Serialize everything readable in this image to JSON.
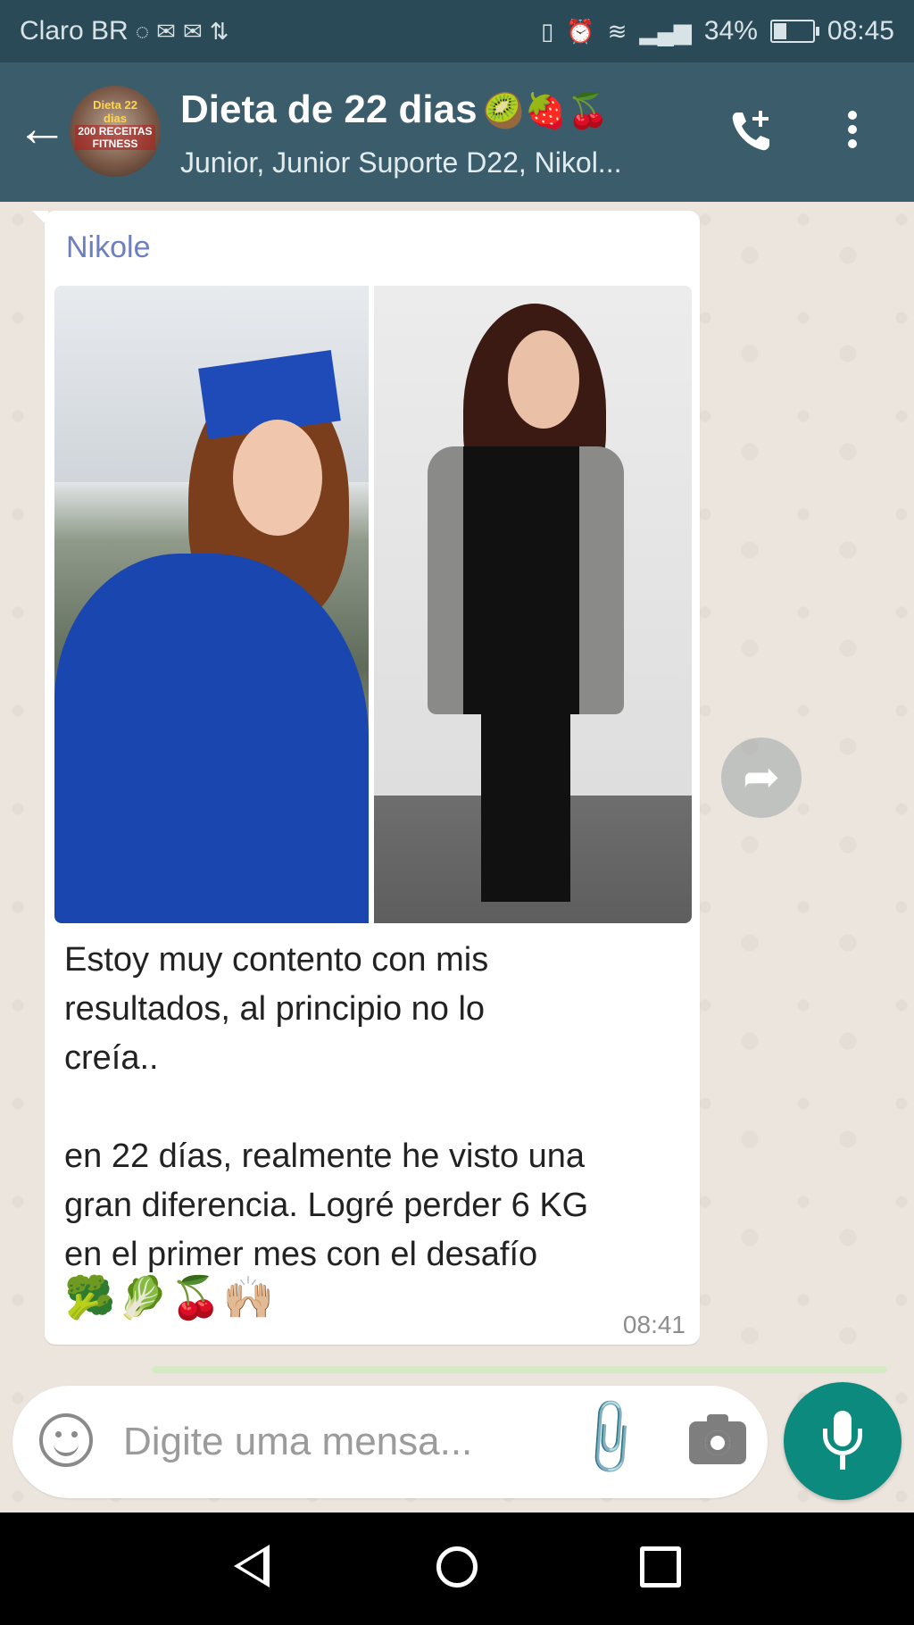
{
  "status_bar": {
    "carrier": "Claro BR",
    "battery": "34%",
    "battery_level": 0.34,
    "time": "08:45",
    "icons": [
      "whatsapp-icon",
      "mail-icon",
      "mail-icon",
      "sync-icon",
      "vibrate-icon",
      "alarm-icon",
      "wifi-icon",
      "signal-icon",
      "battery-icon"
    ]
  },
  "header": {
    "title": "Dieta de 22 dias",
    "title_emojis": "🥝🍓🍒",
    "subtitle": "Junior, Junior Suporte D22, Nikol...",
    "avatar_text_top": "Dieta 22 dias",
    "avatar_text_mid": "200 RECEITAS FITNESS"
  },
  "message": {
    "sender": "Nikole",
    "text": "Estoy muy contento con mis\nresultados, al principio no lo\ncreía..\n\nen 22 días, realmente he visto una\ngran diferencia. Logré perder 6 KG\nen el primer mes con el desafío",
    "emojis": "🥦🥬🍒🙌🏼",
    "time": "08:41"
  },
  "composer": {
    "placeholder": "Digite uma mensa..."
  },
  "colors": {
    "header": "#3b5d6b",
    "status_bar": "#2b4a57",
    "sender": "#6d7fbe",
    "mic_button": "#0b8a7d",
    "chat_bg": "#ece5dd"
  }
}
